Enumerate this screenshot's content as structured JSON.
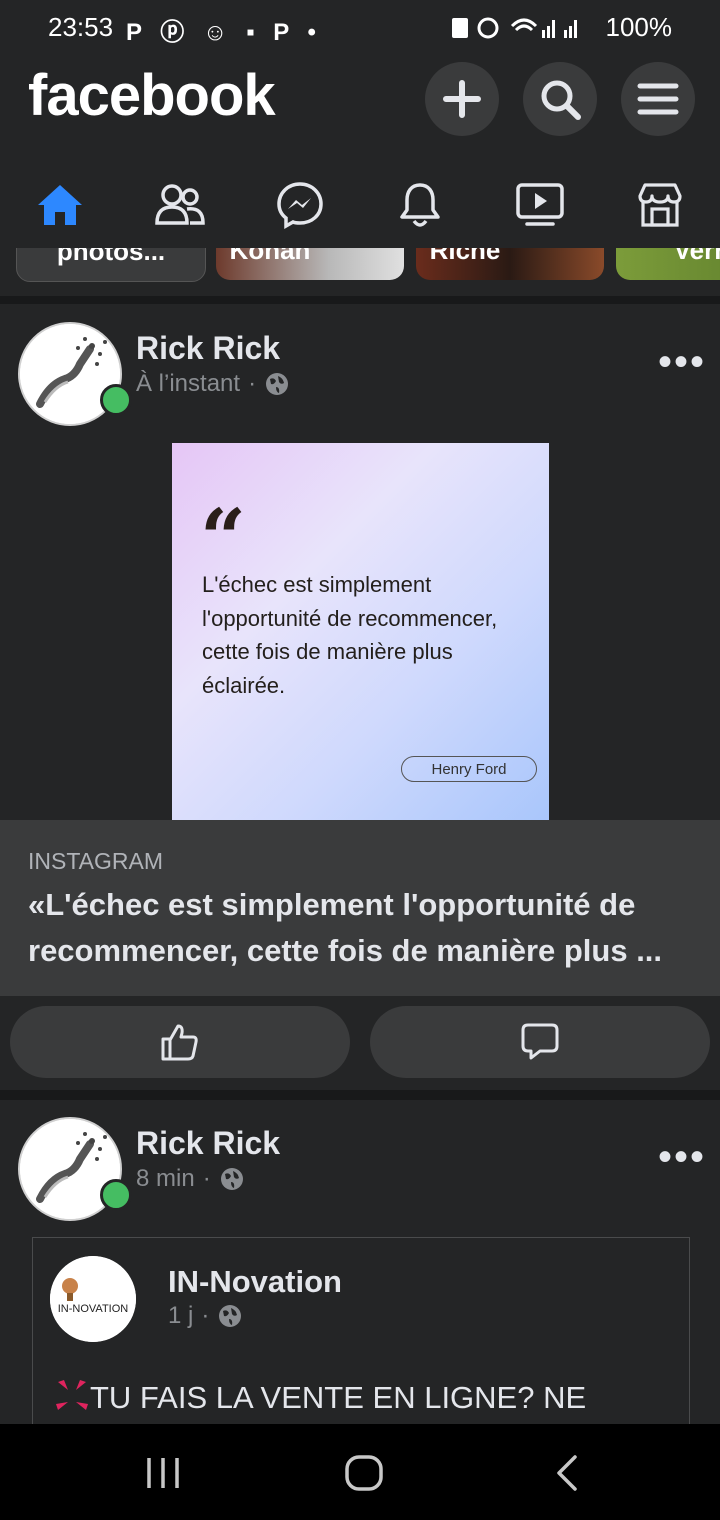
{
  "status": {
    "time": "23:53",
    "left_icons": "P ⓟ ☺ ▪ P •",
    "battery": "100%"
  },
  "header": {
    "logo": "facebook",
    "buttons": [
      "plus-icon",
      "search-icon",
      "menu-icon"
    ]
  },
  "tabs": [
    "home-icon",
    "friends-icon",
    "messenger-icon",
    "notifications-icon",
    "watch-icon",
    "marketplace-icon"
  ],
  "stories": [
    {
      "label": "photos..."
    },
    {
      "label": "Konan"
    },
    {
      "label": "Riche"
    },
    {
      "label": "Vernise"
    }
  ],
  "post1": {
    "author": "Rick Rick",
    "time": "À l’instant",
    "image": {
      "quote": "L'échec est simplement l'opportunité de recommencer, cette fois de manière plus éclairée.",
      "author": "Henry Ford"
    },
    "link": {
      "source": "INSTAGRAM",
      "title": "«L'échec est simplement l'opportunité de recommencer, cette fois de manière plus ..."
    }
  },
  "post2": {
    "author": "Rick Rick",
    "time": "8 min",
    "shared": {
      "author": "IN-Novation",
      "time": "1 j",
      "logo_text": "IN-NOVATION",
      "text": "TU FAIS LA VENTE EN LIGNE? NE"
    }
  },
  "colors": {
    "accent": "#2d88ff",
    "online": "#45bd62",
    "background": "#242526",
    "surface": "#3a3b3c"
  }
}
